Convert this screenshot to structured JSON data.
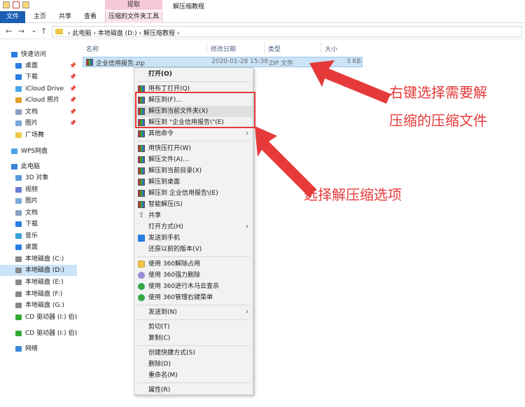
{
  "window": {
    "context_tab_header": "提取",
    "title": "解压缩教程"
  },
  "ribbon": {
    "tabs": [
      "文件",
      "主页",
      "共享",
      "查看",
      "压缩的文件夹工具"
    ]
  },
  "address": {
    "back": "←",
    "forward": "→",
    "down": "⌄",
    "up": "↑",
    "breadcrumb": "›  此电脑  ›  本地磁盘 (D:)  ›  解压缩教程  ›"
  },
  "sidebar": {
    "items": [
      {
        "label": "快速访问",
        "icon": "star-icon",
        "pin": false,
        "sel": false
      },
      {
        "label": "桌面",
        "icon": "desktop-icon",
        "pin": true,
        "sel": false
      },
      {
        "label": "下载",
        "icon": "download-icon",
        "pin": true,
        "sel": false
      },
      {
        "label": "iCloud Drive",
        "icon": "cloud-icon",
        "pin": true,
        "sel": false
      },
      {
        "label": "iCloud 照片",
        "icon": "photos-icon",
        "pin": true,
        "sel": false
      },
      {
        "label": "文档",
        "icon": "document-icon",
        "pin": true,
        "sel": false
      },
      {
        "label": "图片",
        "icon": "picture-icon",
        "pin": true,
        "sel": false
      },
      {
        "label": "广场舞",
        "icon": "folder-icon",
        "pin": false,
        "sel": false
      },
      {
        "label": "WPS网盘",
        "icon": "cloud-icon",
        "pin": false,
        "sel": false
      },
      {
        "label": "此电脑",
        "icon": "computer-icon",
        "pin": false,
        "sel": false
      },
      {
        "label": "3D 对象",
        "icon": "cube-icon",
        "pin": false,
        "sel": false
      },
      {
        "label": "视频",
        "icon": "video-icon",
        "pin": false,
        "sel": false
      },
      {
        "label": "图片",
        "icon": "picture-icon",
        "pin": false,
        "sel": false
      },
      {
        "label": "文档",
        "icon": "document-icon",
        "pin": false,
        "sel": false
      },
      {
        "label": "下载",
        "icon": "download-icon",
        "pin": false,
        "sel": false
      },
      {
        "label": "音乐",
        "icon": "music-icon",
        "pin": false,
        "sel": false
      },
      {
        "label": "桌面",
        "icon": "desktop-icon",
        "pin": false,
        "sel": false
      },
      {
        "label": "本地磁盘 (C:)",
        "icon": "drive-icon",
        "pin": false,
        "sel": false
      },
      {
        "label": "本地磁盘 (D:)",
        "icon": "drive-icon",
        "pin": false,
        "sel": true
      },
      {
        "label": "本地磁盘 (E:)",
        "icon": "drive-icon",
        "pin": false,
        "sel": false
      },
      {
        "label": "本地磁盘 (F:)",
        "icon": "drive-icon",
        "pin": false,
        "sel": false
      },
      {
        "label": "本地磁盘 (G:)",
        "icon": "drive-icon",
        "pin": false,
        "sel": false
      },
      {
        "label": "CD 驱动器 (I:) 伯诗",
        "icon": "cd-icon",
        "pin": false,
        "sel": false
      },
      {
        "label": "CD 驱动器 (I:) 伯诗乐",
        "icon": "cd-icon",
        "pin": false,
        "sel": false
      },
      {
        "label": "网络",
        "icon": "network-icon",
        "pin": false,
        "sel": false
      }
    ]
  },
  "columns": [
    "名称",
    "修改日期",
    "类型",
    "大小"
  ],
  "file": {
    "name": "企业信用报告.zip",
    "date": "2020-01-28 15:38",
    "type": "ZIP 文件",
    "size": "3 KB"
  },
  "menu": {
    "items": [
      {
        "label": "打开(O)",
        "icon": "",
        "bold": true,
        "sub": false,
        "hl": false
      },
      {
        "sep": true
      },
      {
        "label": "用布丁打开(Q)",
        "icon": "rar",
        "sub": false,
        "hl": false
      },
      {
        "label": "解压到(F)...",
        "icon": "rar",
        "sub": false,
        "hl": false
      },
      {
        "label": "解压到当前文件夹(X)",
        "icon": "rar",
        "sub": false,
        "hl": true
      },
      {
        "label": "解压到 \"企业信用报告\\\"(E)",
        "icon": "rar",
        "sub": false,
        "hl": false
      },
      {
        "label": "其他命令",
        "icon": "rar",
        "sub": true,
        "hl": false
      },
      {
        "sep": true
      },
      {
        "label": "用快压打开(W)",
        "icon": "rar",
        "sub": false,
        "hl": false
      },
      {
        "label": "解压文件(A)...",
        "icon": "rar",
        "sub": false,
        "hl": false
      },
      {
        "label": "解压到当前目录(X)",
        "icon": "rar",
        "sub": false,
        "hl": false
      },
      {
        "label": "解压到桌面",
        "icon": "rar",
        "sub": false,
        "hl": false
      },
      {
        "label": "解压到 企业信用报告\\(E)",
        "icon": "rar",
        "sub": false,
        "hl": false
      },
      {
        "label": "智能解压(S)",
        "icon": "rar",
        "sub": false,
        "hl": false
      },
      {
        "label": "共享",
        "icon": "share",
        "sub": false,
        "hl": false
      },
      {
        "label": "打开方式(H)",
        "icon": "",
        "sub": true,
        "hl": false
      },
      {
        "label": "发送到手机",
        "icon": "phone",
        "sub": false,
        "hl": false
      },
      {
        "label": "还原以前的版本(V)",
        "icon": "",
        "sub": false,
        "hl": false
      },
      {
        "sep": true
      },
      {
        "label": "使用 360解除占用",
        "icon": "360b",
        "sub": false,
        "hl": false
      },
      {
        "label": "使用 360强力删除",
        "icon": "purple",
        "sub": false,
        "hl": false
      },
      {
        "label": "使用 360进行木马云查杀",
        "icon": "360",
        "sub": false,
        "hl": false
      },
      {
        "label": "使用 360管理右键菜单",
        "icon": "360",
        "sub": false,
        "hl": false
      },
      {
        "sep": true
      },
      {
        "label": "发送到(N)",
        "icon": "",
        "sub": true,
        "hl": false
      },
      {
        "sep": true
      },
      {
        "label": "剪切(T)",
        "icon": "",
        "sub": false,
        "hl": false
      },
      {
        "label": "复制(C)",
        "icon": "",
        "sub": false,
        "hl": false
      },
      {
        "sep": true
      },
      {
        "label": "创建快捷方式(S)",
        "icon": "",
        "sub": false,
        "hl": false
      },
      {
        "label": "删除(D)",
        "icon": "",
        "sub": false,
        "hl": false
      },
      {
        "label": "重命名(M)",
        "icon": "",
        "sub": false,
        "hl": false
      },
      {
        "sep": true
      },
      {
        "label": "属性(R)",
        "icon": "",
        "sub": false,
        "hl": false
      }
    ]
  },
  "annotations": {
    "top_line1": "右键选择需要解",
    "top_line2": "压缩的压缩文件",
    "bottom": "选择解压缩选项"
  },
  "colors": {
    "accent": "#1a5fb4",
    "annotation": "#e63a3a",
    "selection": "#cce4f7",
    "context_tab": "#f7c8d8"
  }
}
